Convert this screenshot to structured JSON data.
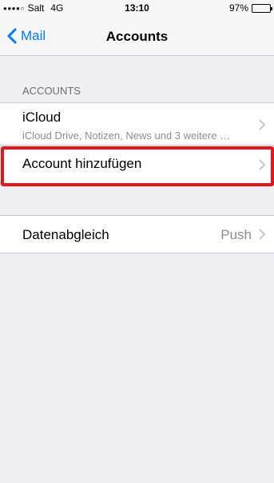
{
  "status_bar": {
    "signal": "●●●●○",
    "carrier": "Salt",
    "network": "4G",
    "time": "13:10",
    "battery_percent": "97%",
    "battery_level": 0.97
  },
  "nav": {
    "back_label": "Mail",
    "title": "Accounts"
  },
  "accounts_section": {
    "header": "ACCOUNTS",
    "items": [
      {
        "title": "iCloud",
        "subtitle": "iCloud Drive, Notizen, News und 3 weitere …",
        "icon": "chevron-right-icon"
      },
      {
        "title": "Account hinzufügen",
        "icon": "chevron-right-icon"
      }
    ]
  },
  "sync_section": {
    "title": "Datenabgleich",
    "value": "Push",
    "icon": "chevron-right-icon"
  },
  "colors": {
    "accent": "#007aff",
    "background": "#efeff4",
    "highlight": "#e8141c",
    "secondary_text": "#8e8e93"
  }
}
